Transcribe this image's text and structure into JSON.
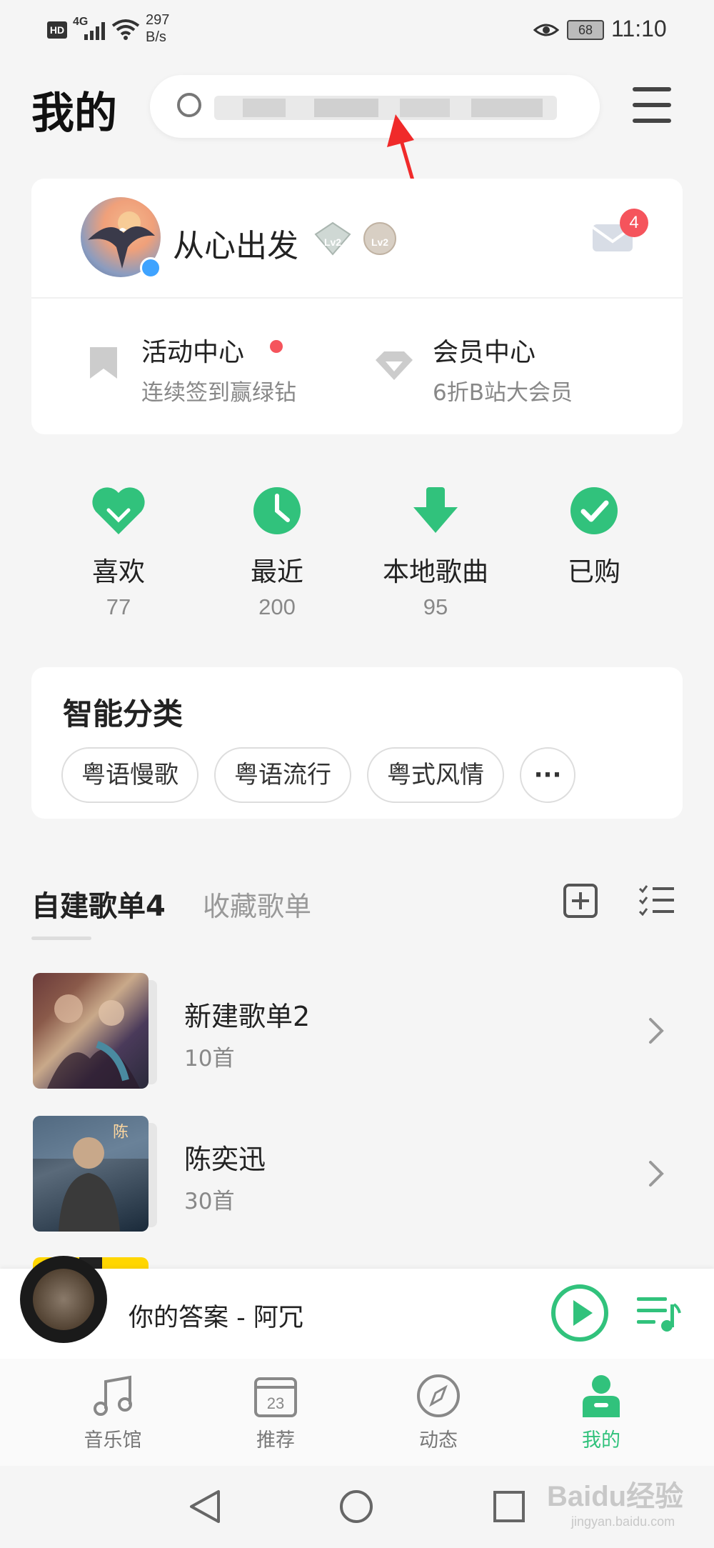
{
  "status_bar": {
    "hd": "HD",
    "network": "4G",
    "speed_value": "297",
    "speed_unit": "B/s",
    "battery": "68",
    "time": "11:10"
  },
  "header": {
    "title": "我的",
    "search_placeholder": ""
  },
  "profile": {
    "username": "从心出发",
    "badges": [
      "Lv2",
      "Lv2"
    ],
    "mail_count": "4"
  },
  "shortcuts": {
    "activity": {
      "title": "活动中心",
      "subtitle": "连续签到赢绿钻"
    },
    "vip": {
      "title": "会员中心",
      "subtitle": "6折B站大会员"
    }
  },
  "quick_items": [
    {
      "label": "喜欢",
      "count": "77",
      "icon": "heart-icon"
    },
    {
      "label": "最近",
      "count": "200",
      "icon": "clock-icon"
    },
    {
      "label": "本地歌曲",
      "count": "95",
      "icon": "download-icon"
    },
    {
      "label": "已购",
      "count": "",
      "icon": "check-icon"
    }
  ],
  "smart_category": {
    "title": "智能分类",
    "chips": [
      "粤语慢歌",
      "粤语流行",
      "粤式风情"
    ],
    "more_label": "···"
  },
  "playlists_section": {
    "own_tab": "自建歌单4",
    "fav_tab": "收藏歌单",
    "items": [
      {
        "title": "新建歌单2",
        "count": "10首"
      },
      {
        "title": "陈奕迅",
        "count": "30首"
      }
    ]
  },
  "player": {
    "now_playing": "你的答案 - 阿冗"
  },
  "bottom_nav": [
    {
      "label": "音乐馆",
      "icon": "music-note-icon"
    },
    {
      "label": "推荐",
      "icon": "calendar-icon",
      "day": "23"
    },
    {
      "label": "动态",
      "icon": "compass-icon"
    },
    {
      "label": "我的",
      "icon": "person-icon"
    }
  ],
  "watermark": {
    "text": "Baidu经验",
    "sub": "jingyan.baidu.com"
  },
  "colors": {
    "accent": "#31c27c",
    "badge_red": "#f5545c",
    "background": "#f5f5f5"
  }
}
